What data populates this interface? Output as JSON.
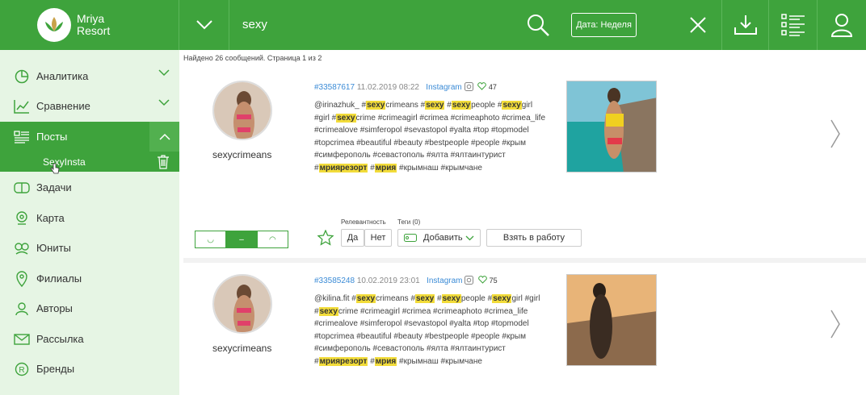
{
  "header": {
    "logo_line1": "Mriya",
    "logo_line2": "Resort",
    "search_value": "sexy",
    "date_button": "Дата: Неделя"
  },
  "colors": {
    "brand": "#3ea33c",
    "sidebar_bg": "#e6f5e4",
    "highlight": "#f2dc3a",
    "link": "#3b8bd6"
  },
  "sidebar": {
    "items": [
      {
        "label": "Аналитика",
        "icon": "pie-chart-icon"
      },
      {
        "label": "Сравнение",
        "icon": "line-chart-icon"
      },
      {
        "label": "Посты",
        "icon": "posts-list-icon"
      },
      {
        "label": "Задачи",
        "icon": "tasks-icon"
      },
      {
        "label": "Карта",
        "icon": "map-pin-icon"
      },
      {
        "label": "Юниты",
        "icon": "units-icon"
      },
      {
        "label": "Филиалы",
        "icon": "branch-icon"
      },
      {
        "label": "Авторы",
        "icon": "authors-icon"
      },
      {
        "label": "Рассылка",
        "icon": "mail-icon"
      },
      {
        "label": "Бренды",
        "icon": "brand-icon"
      }
    ],
    "subitem": "SexyInsta"
  },
  "results_info": "Найдено 26 сообщений. Страница 1 из 2",
  "posts": [
    {
      "author": "sexycrimeans",
      "id": "#33587617",
      "date": "11.02.2019 08:22",
      "source": "Instagram",
      "likes": "47",
      "text_parts": [
        [
          "@irinazhuk_ #",
          false
        ],
        [
          "sexy",
          true
        ],
        [
          "crimeans #",
          false
        ],
        [
          "sexy",
          true
        ],
        [
          " #",
          false
        ],
        [
          "sexy",
          true
        ],
        [
          "people #",
          false
        ],
        [
          "sexy",
          true
        ],
        [
          "girl #girl #",
          false
        ],
        [
          "sexy",
          true
        ],
        [
          "crime #crimeagirl #crimea #crimeaphoto #crimea_life #crimealove #simferopol #sevastopol #yalta #top #topmodel #topcrimea #beautiful #beauty #bestpeople #people #крым #симферополь #севастополь #ялта #ялтаинтурист #",
          false
        ],
        [
          "мриярезорт",
          true
        ],
        [
          " #",
          false
        ],
        [
          "мрия",
          true
        ],
        [
          " #крымнаш #крымчане",
          false
        ]
      ],
      "relevance_label": "Релевантность",
      "yes": "Да",
      "no": "Нет",
      "tags_label": "Теги (0)",
      "add_label": "Добавить",
      "take_label": "Взять в работу"
    },
    {
      "author": "sexycrimeans",
      "id": "#33585248",
      "date": "10.02.2019 23:01",
      "source": "Instagram",
      "likes": "75",
      "text_parts": [
        [
          "@kilina.fit #",
          false
        ],
        [
          "sexy",
          true
        ],
        [
          "crimeans #",
          false
        ],
        [
          "sexy",
          true
        ],
        [
          " #",
          false
        ],
        [
          "sexy",
          true
        ],
        [
          "people #",
          false
        ],
        [
          "sexy",
          true
        ],
        [
          "girl #girl #",
          false
        ],
        [
          "sexy",
          true
        ],
        [
          "crime #crimeagirl #crimea #crimeaphoto #crimea_life #crimealove #simferopol #sevastopol #yalta #top #topmodel #topcrimea #beautiful #beauty #bestpeople #people #крым #симферополь #севастополь #ялта #ялтаинтурист #",
          false
        ],
        [
          "мриярезорт",
          true
        ],
        [
          " #",
          false
        ],
        [
          "мрия",
          true
        ],
        [
          " #крымнаш #крымчане",
          false
        ]
      ]
    }
  ]
}
